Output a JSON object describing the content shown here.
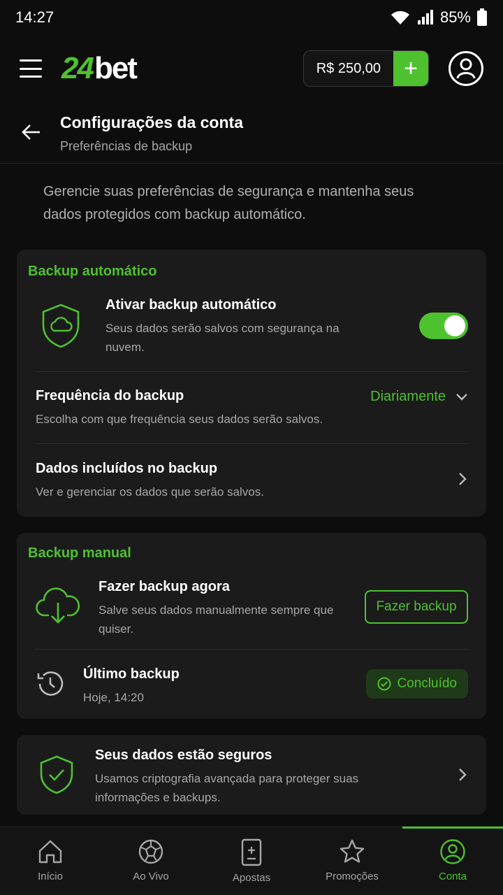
{
  "status_bar": {
    "time": "14:27",
    "battery": "85%"
  },
  "header": {
    "logo_number": "24",
    "logo_text": "bet",
    "balance": "R$ 250,00",
    "add_symbol": "+"
  },
  "page": {
    "title": "Configurações da conta",
    "subtitle": "Preferências de backup",
    "intro": "Gerencie suas preferências de segurança e mantenha seus dados protegidos com backup automático."
  },
  "auto_backup": {
    "section_title": "Backup automático",
    "enable_title": "Ativar backup automático",
    "enable_desc": "Seus dados serão salvos com segurança na nuvem.",
    "enabled": true,
    "frequency_title": "Frequência do backup",
    "frequency_desc": "Escolha com que frequência seus dados serão salvos.",
    "frequency_value": "Diariamente",
    "data_title": "Dados incluídos no backup",
    "data_desc": "Ver e gerenciar os dados que serão salvos."
  },
  "manual_backup": {
    "section_title": "Backup manual",
    "now_title": "Fazer backup agora",
    "now_desc": "Salve seus dados manualmente sempre que quiser.",
    "button_label": "Fazer backup",
    "last_title": "Último backup",
    "last_time": "Hoje, 14:20",
    "status_label": "Concluído"
  },
  "security": {
    "title": "Seus dados estão seguros",
    "desc": "Usamos criptografia avançada para proteger suas informações e backups."
  },
  "bottom_nav": {
    "items": [
      {
        "label": "Início",
        "icon": "home-icon"
      },
      {
        "label": "Ao Vivo",
        "icon": "soccer-ball-icon"
      },
      {
        "label": "Apostas",
        "icon": "ticket-icon"
      },
      {
        "label": "Promoções",
        "icon": "star-icon"
      },
      {
        "label": "Conta",
        "icon": "user-icon",
        "active": true
      }
    ]
  },
  "colors": {
    "accent": "#4ec12f",
    "background": "#0d0d0d",
    "card": "#1b1b1c"
  }
}
